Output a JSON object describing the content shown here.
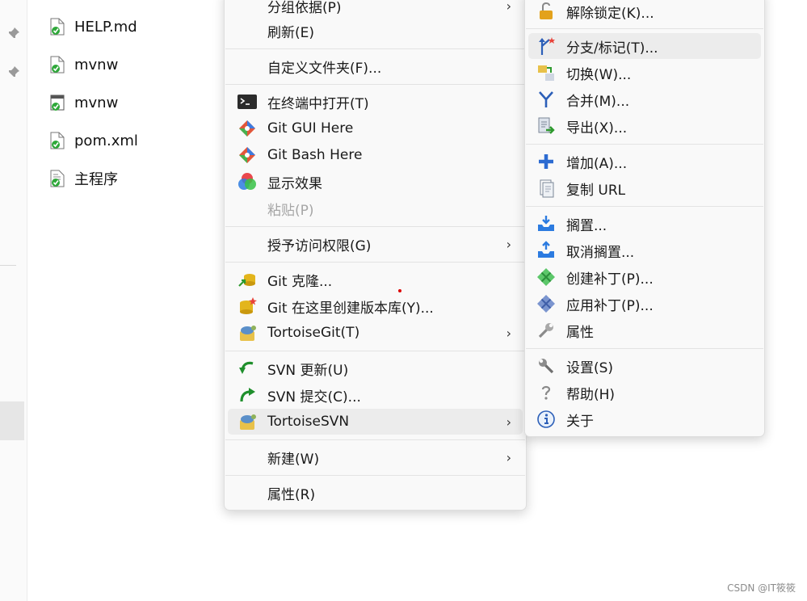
{
  "files": [
    {
      "name": "HELP.md",
      "icon": "markdown-file-icon"
    },
    {
      "name": "mvnw",
      "icon": "file-icon"
    },
    {
      "name": "mvnw",
      "icon": "script-file-icon"
    },
    {
      "name": "pom.xml",
      "icon": "xml-file-icon"
    },
    {
      "name": "主程序",
      "icon": "document-file-icon"
    }
  ],
  "context_menu": {
    "items": [
      {
        "label": "分组依据(P)",
        "arrow": "›"
      },
      {
        "label": "刷新(E)"
      },
      {
        "label": "自定义文件夹(F)..."
      },
      {
        "label": "在终端中打开(T)",
        "icon": "terminal-icon"
      },
      {
        "label": "Git GUI Here",
        "icon": "git-icon"
      },
      {
        "label": "Git Bash Here",
        "icon": "git-icon"
      },
      {
        "label": "显示效果",
        "icon": "color-effects-icon"
      },
      {
        "label": "粘贴(P)",
        "disabled": true
      },
      {
        "label": "授予访问权限(G)",
        "arrow": "›"
      },
      {
        "label": "Git 克隆...",
        "icon": "git-clone-icon"
      },
      {
        "label": "Git 在这里创建版本库(Y)...",
        "icon": "git-create-repo-icon"
      },
      {
        "label": "TortoiseGit(T)",
        "icon": "tortoisegit-icon",
        "arrow": "›"
      },
      {
        "label": "SVN 更新(U)",
        "icon": "svn-update-icon"
      },
      {
        "label": "SVN 提交(C)...",
        "icon": "svn-commit-icon"
      },
      {
        "label": "TortoiseSVN",
        "icon": "tortoisesvn-icon",
        "arrow": "›"
      },
      {
        "label": "新建(W)",
        "arrow": "›"
      },
      {
        "label": "属性(R)"
      }
    ]
  },
  "submenu": {
    "items": [
      {
        "label": "解除锁定(K)...",
        "icon": "unlock-icon"
      },
      {
        "label": "分支/标记(T)...",
        "icon": "branch-tag-icon"
      },
      {
        "label": "切换(W)...",
        "icon": "switch-icon"
      },
      {
        "label": "合并(M)...",
        "icon": "merge-icon"
      },
      {
        "label": "导出(X)...",
        "icon": "export-icon"
      },
      {
        "label": "增加(A)...",
        "icon": "add-icon"
      },
      {
        "label": "复制 URL",
        "icon": "copy-url-icon"
      },
      {
        "label": "搁置...",
        "icon": "shelve-icon"
      },
      {
        "label": "取消搁置...",
        "icon": "unshelve-icon"
      },
      {
        "label": "创建补丁(P)...",
        "icon": "create-patch-icon"
      },
      {
        "label": "应用补丁(P)...",
        "icon": "apply-patch-icon"
      },
      {
        "label": "属性",
        "icon": "properties-wrench-icon"
      },
      {
        "label": "设置(S)",
        "icon": "settings-wrench-icon"
      },
      {
        "label": "帮助(H)",
        "icon": "help-icon"
      },
      {
        "label": "关于",
        "icon": "about-info-icon"
      }
    ]
  },
  "watermark": "CSDN @IT筱筱"
}
